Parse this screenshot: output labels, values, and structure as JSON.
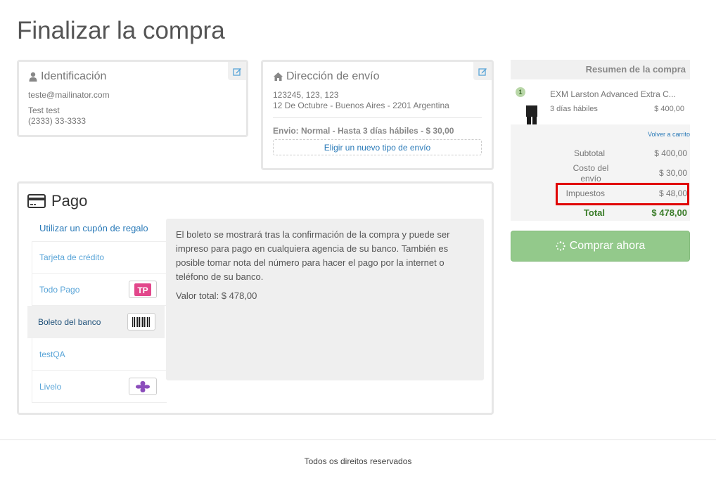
{
  "page": {
    "title": "Finalizar la compra"
  },
  "identification": {
    "title": "Identificación",
    "email": "teste@mailinator.com",
    "name": "Test test",
    "phone": "(2333) 33-3333"
  },
  "shipping": {
    "title": "Dirección de envío",
    "address_line1": "123245, 123, 123",
    "address_line2": "12 De Octubre - Buenos Aires - 2201 Argentina",
    "method": "Envio: Normal - Hasta 3 días hábiles - $ 30,00",
    "change_label": "Eligir un nuevo tipo de envío"
  },
  "payment": {
    "title": "Pago",
    "coupon_label": "Utilizar un cupón de regalo",
    "methods": [
      {
        "label": "Tarjeta de crédito",
        "icon": "none"
      },
      {
        "label": "Todo Pago",
        "icon": "todopago-logo"
      },
      {
        "label": "Boleto del banco",
        "icon": "barcode-icon"
      },
      {
        "label": "testQA",
        "icon": "none"
      },
      {
        "label": "Livelo",
        "icon": "livelo-logo"
      }
    ],
    "active_method": "Boleto del banco",
    "description": "El boleto se mostrará tras la confirmación de la compra y puede ser impreso para pago en cualquiera agencia de su banco. También es posible tomar nota del número para hacer el pago por la internet o teléfono de su banco.",
    "total_label": "Valor total: $ 478,00"
  },
  "summary": {
    "title": "Resumen de la compra",
    "item": {
      "qty": "1",
      "name": "EXM Larston Advanced Extra C...",
      "delivery": "3 días hábiles",
      "price": "$ 400,00"
    },
    "back_to_cart": "Volver a carrito",
    "subtotal_label": "Subtotal",
    "subtotal": "$ 400,00",
    "shipping_label": "Costo del envío",
    "shipping": "$ 30,00",
    "tax_label": "Impuestos",
    "tax": "$ 48,00",
    "total_label": "Total",
    "total": "$ 478,00",
    "buy_label": "Comprar ahora"
  },
  "footer": {
    "text": "Todos os direitos reservados"
  },
  "colors": {
    "accent": "#2a7ab8",
    "buy_button": "#93c98b",
    "highlight": "#e00000",
    "total": "#3b7d2a"
  }
}
